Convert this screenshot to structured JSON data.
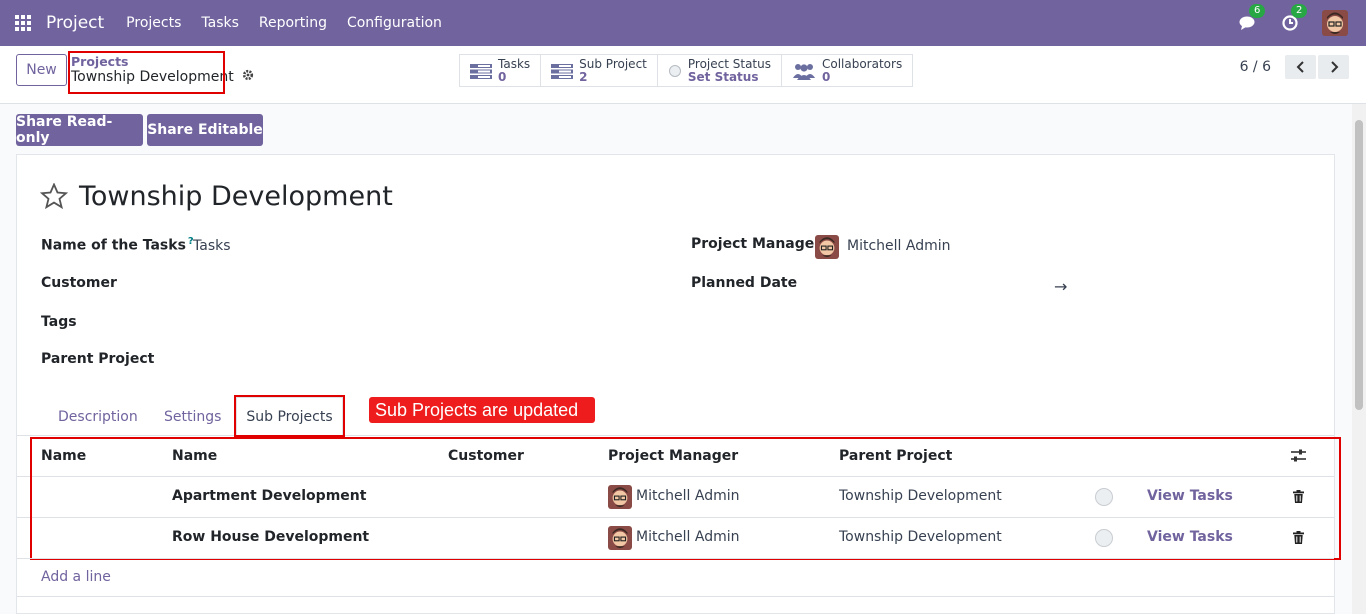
{
  "navbar": {
    "app_name": "Project",
    "menu": [
      "Projects",
      "Tasks",
      "Reporting",
      "Configuration"
    ],
    "messages_count": "6",
    "activities_count": "2",
    "color": "#71639e"
  },
  "control": {
    "new_label": "New",
    "breadcrumb_parent": "Projects",
    "breadcrumb_current": "Township Development",
    "smart_buttons": [
      {
        "label": "Tasks",
        "value": "0",
        "icon": "tasks-icon"
      },
      {
        "label": "Sub Project",
        "value": "2",
        "icon": "tasks-icon"
      },
      {
        "label": "Project Status",
        "value": "Set Status",
        "icon": "status-circle-icon"
      },
      {
        "label": "Collaborators",
        "value": "0",
        "icon": "users-icon"
      }
    ],
    "pager": "6 / 6"
  },
  "share": {
    "read_only": "Share Read-only",
    "editable": "Share Editable"
  },
  "form": {
    "title": "Township Development",
    "fields_left": [
      {
        "label": "Name of the Tasks",
        "value": "Tasks"
      },
      {
        "label": "Customer",
        "value": ""
      },
      {
        "label": "Tags",
        "value": ""
      },
      {
        "label": "Parent Project",
        "value": ""
      }
    ],
    "help_mark": "?",
    "project_manager_label": "Project Manager",
    "project_manager_value": "Mitchell Admin",
    "planned_date_label": "Planned Date",
    "planned_date_arrow": "→"
  },
  "tabs": [
    "Description",
    "Settings",
    "Sub Projects"
  ],
  "annotation": "Sub Projects are updated",
  "table": {
    "headers": [
      "Name",
      "Name",
      "Customer",
      "Project Manager",
      "Parent Project"
    ],
    "rows": [
      {
        "name": "Apartment Development",
        "customer": "",
        "manager": "Mitchell Admin",
        "parent": "Township Development",
        "action": "View Tasks"
      },
      {
        "name": "Row House Development",
        "customer": "",
        "manager": "Mitchell Admin",
        "parent": "Township Development",
        "action": "View Tasks"
      }
    ],
    "add_line": "Add a line"
  }
}
